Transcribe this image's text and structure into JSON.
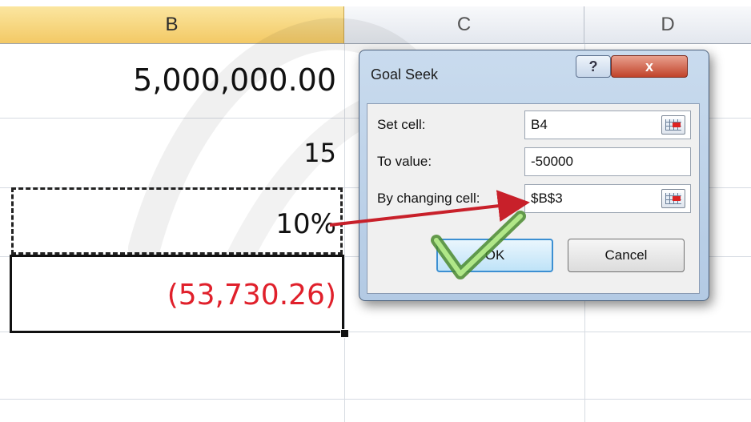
{
  "columns": {
    "b": "B",
    "c": "C",
    "d": "D"
  },
  "cells": {
    "b1": "5,000,000.00",
    "b2": "15",
    "b3": "10%",
    "b4": "(53,730.26)"
  },
  "dialog": {
    "title": "Goal Seek",
    "help_label": "?",
    "close_label": "x",
    "set_cell_label": "Set cell:",
    "set_cell_value": "B4",
    "to_value_label": "To value:",
    "to_value_value": "-50000",
    "changing_cell_label": "By changing cell:",
    "changing_cell_value": "$B$3",
    "ok_label": "OK",
    "cancel_label": "Cancel"
  },
  "icons": [
    "cell-reference-icon",
    "checkmark-icon",
    "arrow-icon"
  ],
  "colors": {
    "negative": "#e0202b",
    "selected_column": "#f3c965",
    "arrow": "#c8202a"
  }
}
